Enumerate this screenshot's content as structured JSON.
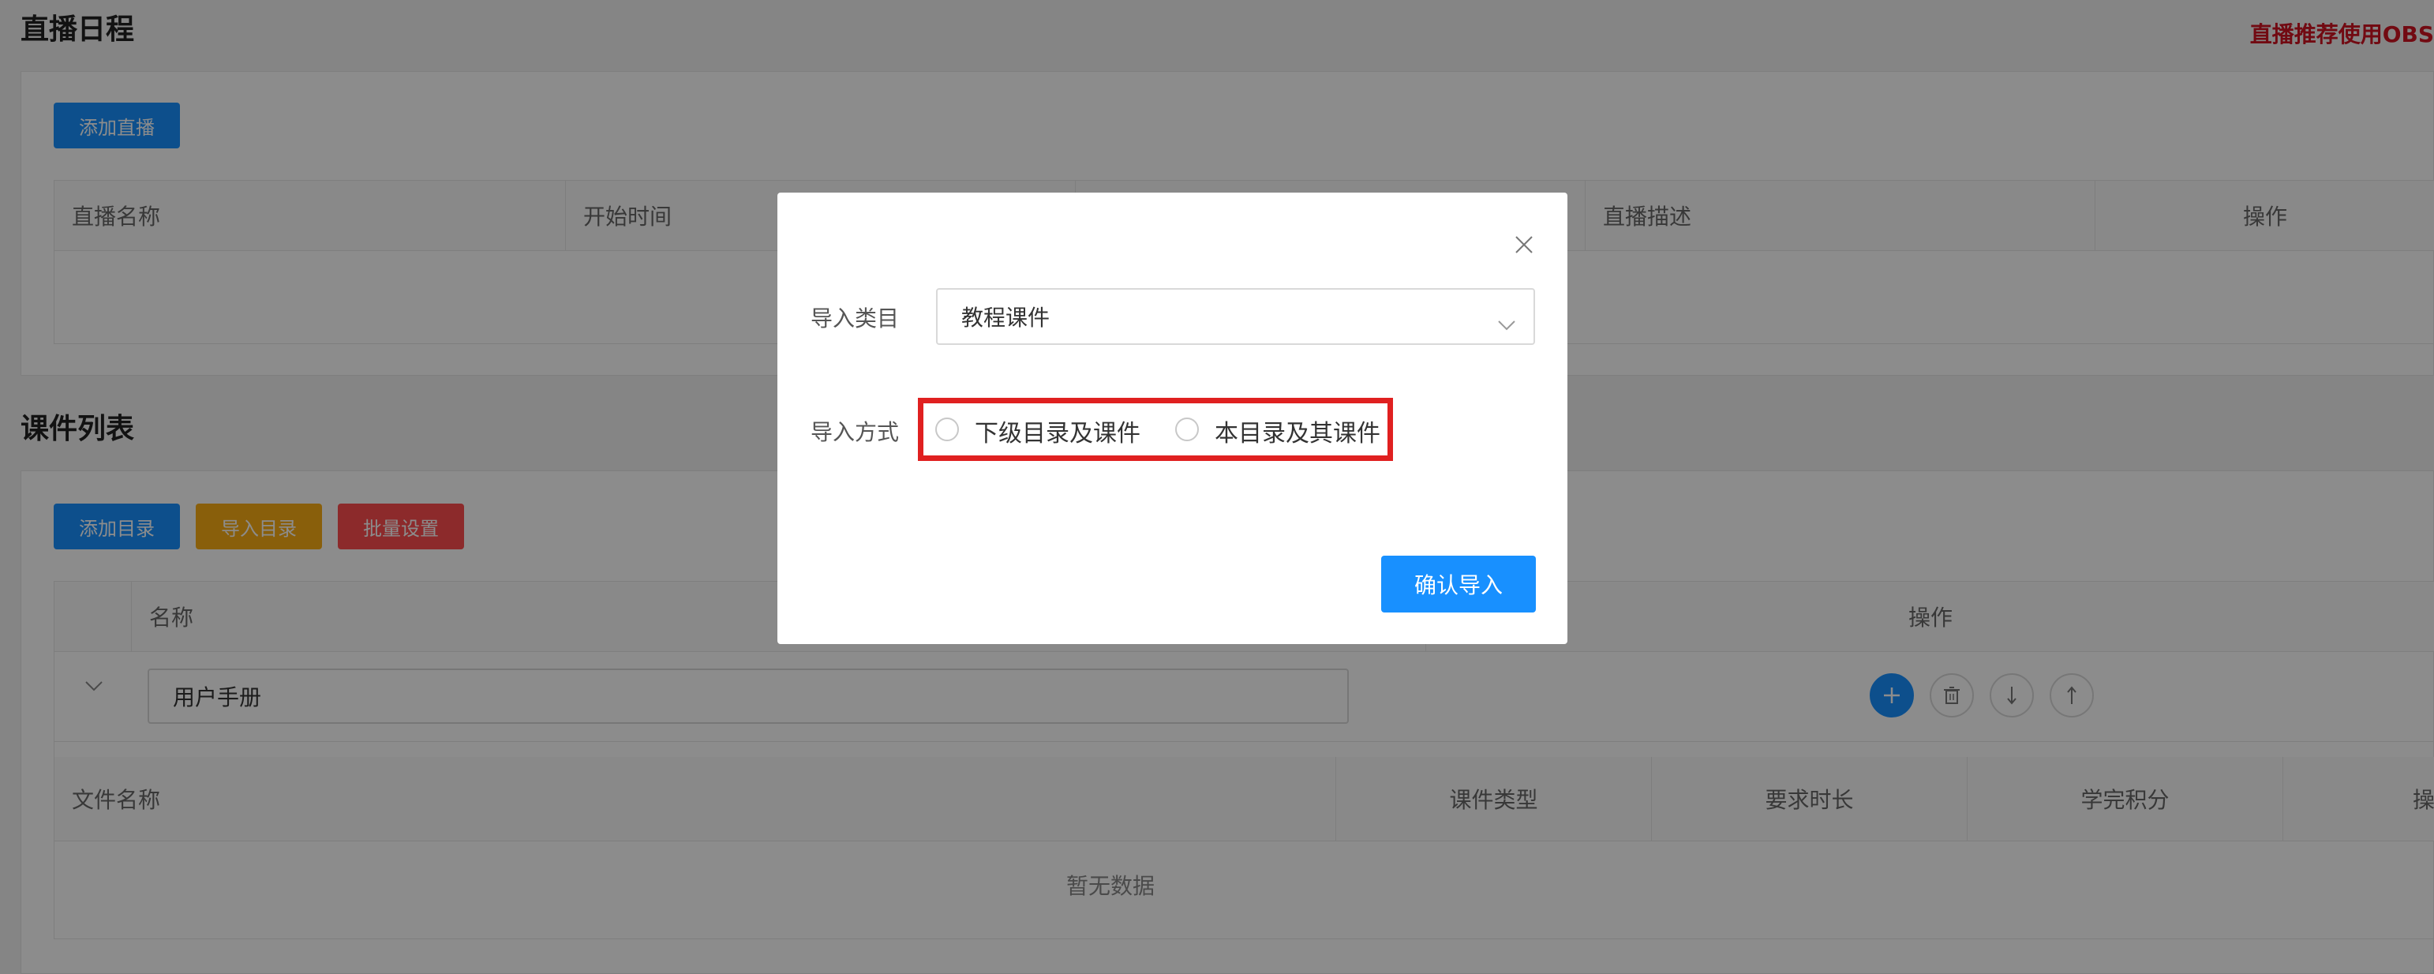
{
  "live": {
    "title": "直播日程",
    "obs_tip": "直播推荐使用OBS",
    "add_button": "添加直播",
    "columns": [
      "直播名称",
      "开始时间",
      "",
      "直播描述",
      "操作"
    ]
  },
  "courseware": {
    "title": "课件列表",
    "buttons": {
      "add_dir": "添加目录",
      "import_dir": "导入目录",
      "batch": "批量设置"
    },
    "columns": {
      "name": "名称",
      "ops": "操作"
    },
    "row_name": "用户手册",
    "file_columns": [
      "文件名称",
      "课件类型",
      "要求时长",
      "学完积分",
      "操"
    ],
    "empty_text": "暂无数据"
  },
  "modal": {
    "close_glyph": "×",
    "category_label": "导入类目",
    "category_value": "教程课件",
    "method_label": "导入方式",
    "options": [
      "下级目录及课件",
      "本目录及其课件"
    ],
    "confirm": "确认导入"
  },
  "icons": {
    "add": "plus-icon",
    "delete": "trash-icon",
    "down": "arrow-down-icon",
    "up": "arrow-up-icon",
    "expand": "chevron-down-icon",
    "select": "chevron-down-icon",
    "close": "close-icon"
  },
  "colors": {
    "primary": "#1890ff",
    "warning": "#faad14",
    "danger": "#ff4d4f",
    "highlight": "#e02020",
    "obs_tip": "#cf1322"
  }
}
